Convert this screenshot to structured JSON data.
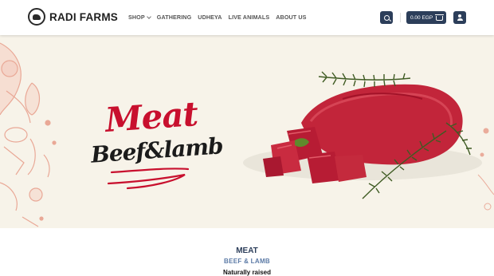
{
  "brand": {
    "name": "RADI FARMS"
  },
  "nav": {
    "items": [
      {
        "label": "SHOP",
        "has_dropdown": true
      },
      {
        "label": "GATHERING"
      },
      {
        "label": "UDHEYA"
      },
      {
        "label": "LIVE ANIMALS"
      },
      {
        "label": "ABOUT US"
      }
    ]
  },
  "header": {
    "search_icon": "search-icon",
    "cart_value": "0.00 EGP",
    "cart_icon": "basket-icon",
    "account_icon": "user-icon"
  },
  "hero": {
    "headline": "Meat",
    "subheadline": "Beef&lamb",
    "background": "#f7f3e9",
    "accent": "#c8102e"
  },
  "section": {
    "title": "MEAT",
    "subtitle": "BEEF & LAMB",
    "tagline": "Naturally raised"
  },
  "colors": {
    "primary": "#2c3e5a",
    "accent": "#c8102e",
    "subtitle": "#5b7aa6"
  }
}
